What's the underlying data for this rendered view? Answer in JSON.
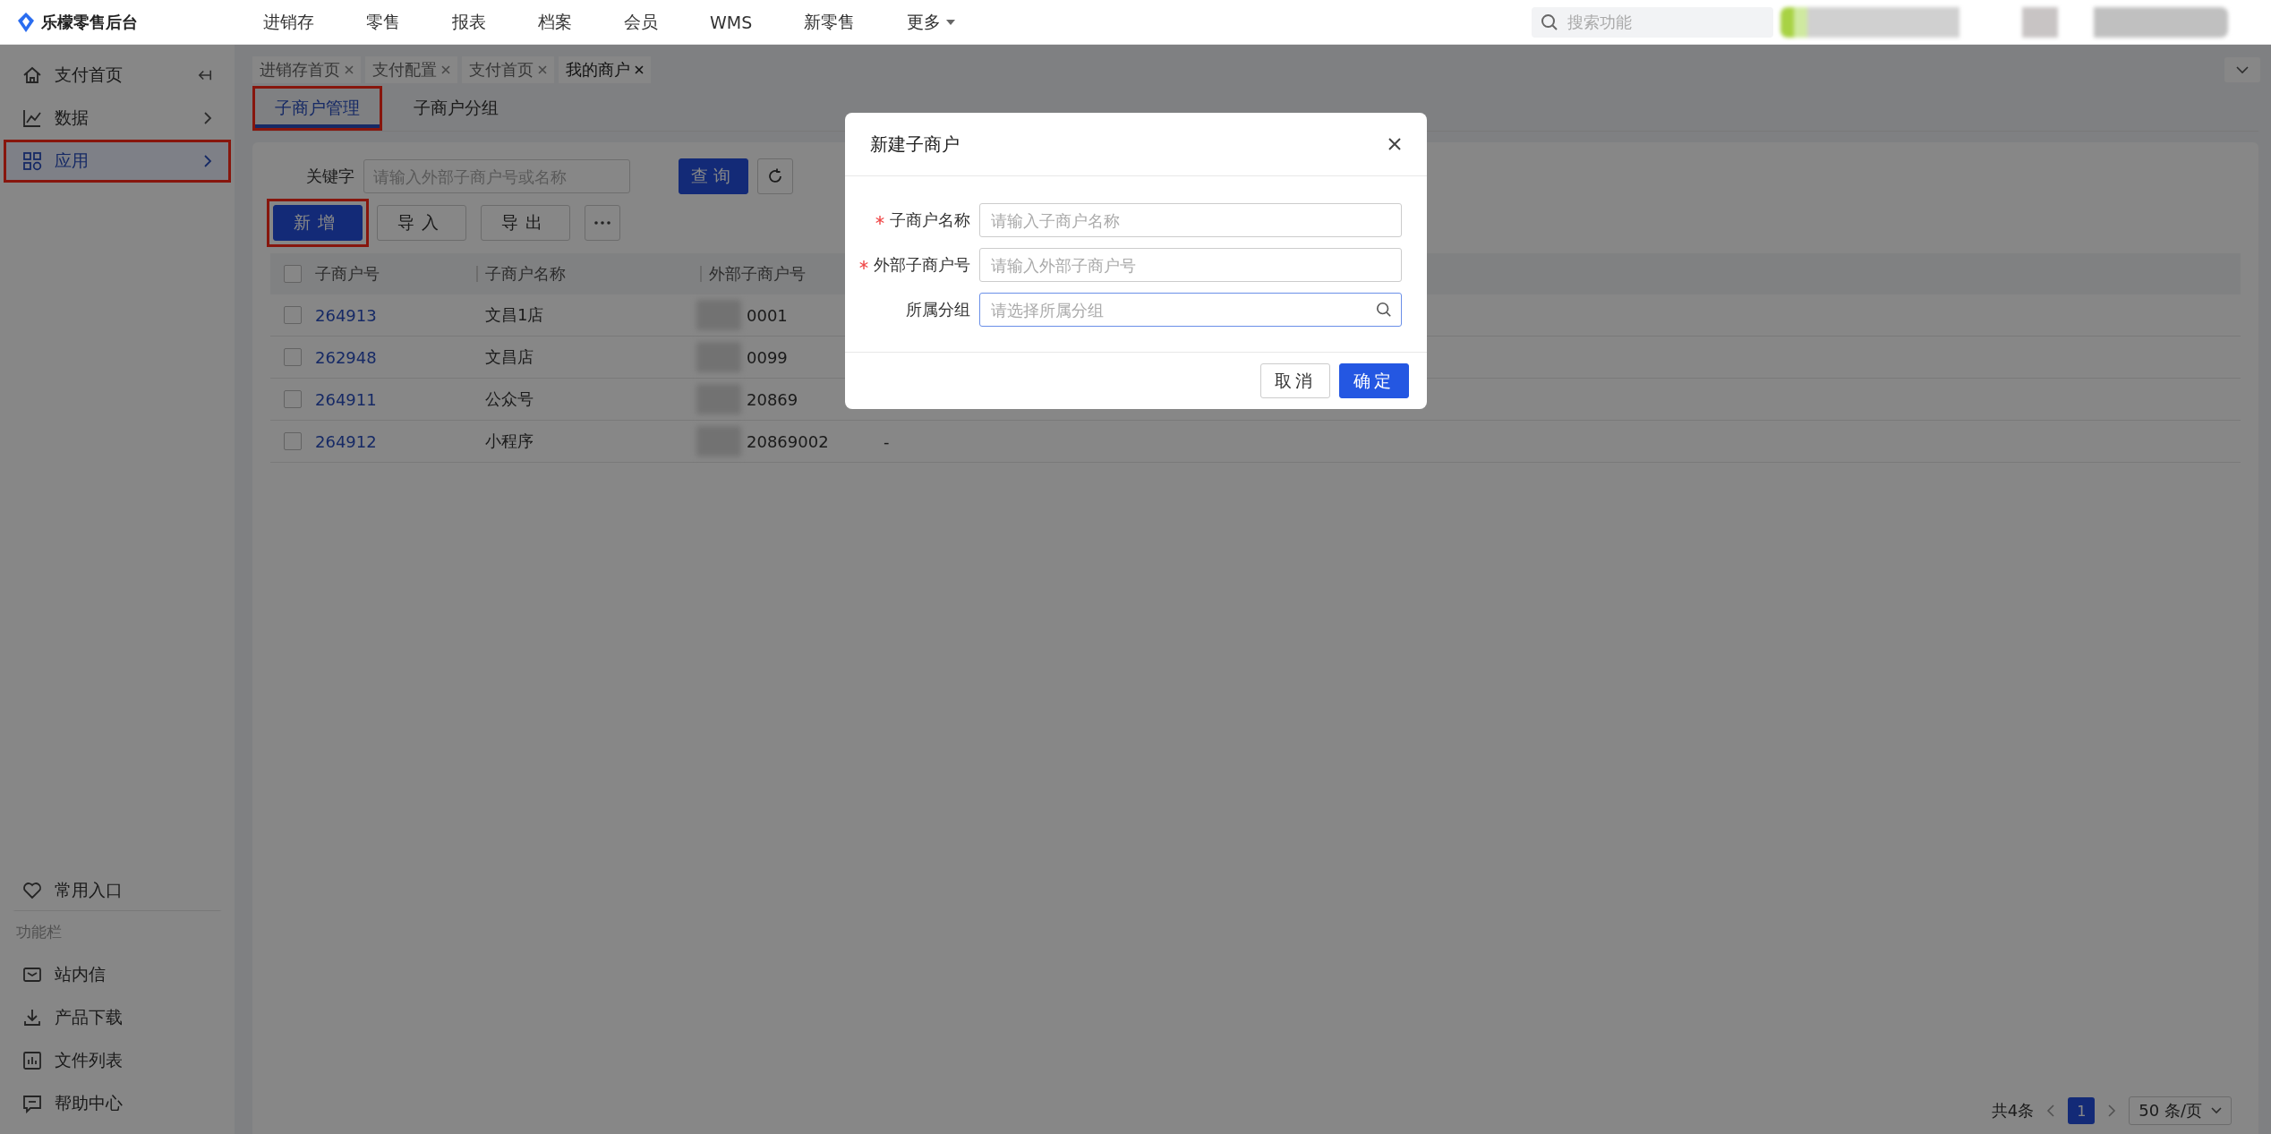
{
  "app": {
    "name": "乐檬零售后台"
  },
  "top_nav": [
    {
      "label": "进销存",
      "kind": "link"
    },
    {
      "label": "零售",
      "kind": "link"
    },
    {
      "label": "报表",
      "kind": "link"
    },
    {
      "label": "档案",
      "kind": "link"
    },
    {
      "label": "会员",
      "kind": "link"
    },
    {
      "label": "WMS",
      "kind": "link"
    },
    {
      "label": "新零售",
      "kind": "link"
    },
    {
      "label": "更多",
      "kind": "dropdown"
    }
  ],
  "search": {
    "placeholder": "搜索功能"
  },
  "page_tabs": [
    {
      "label": "进销存首页",
      "selected": false
    },
    {
      "label": "支付配置",
      "selected": false
    },
    {
      "label": "支付首页",
      "selected": false
    },
    {
      "label": "我的商户",
      "selected": true
    }
  ],
  "sidebar": {
    "items": [
      {
        "label": "支付首页",
        "selected": false,
        "highlighted": false
      },
      {
        "label": "数据",
        "selected": false,
        "highlighted": false
      },
      {
        "label": "应用",
        "selected": true,
        "highlighted": true
      }
    ],
    "favorites": "常用入口",
    "section_title": "功能栏",
    "tools": [
      {
        "label": "站内信"
      },
      {
        "label": "产品下载"
      },
      {
        "label": "文件列表"
      },
      {
        "label": "帮助中心"
      }
    ]
  },
  "subtabs": [
    {
      "label": "子商户管理",
      "selected": true,
      "highlighted": true
    },
    {
      "label": "子商户分组",
      "selected": false,
      "highlighted": false
    }
  ],
  "filter": {
    "label": "关键字",
    "placeholder": "请输入外部子商户号或名称",
    "query_button": "查询"
  },
  "actions": [
    {
      "label": "新增",
      "kind": "primary",
      "highlighted": true
    },
    {
      "label": "导入",
      "kind": "default",
      "highlighted": false
    },
    {
      "label": "导出",
      "kind": "default",
      "highlighted": false
    },
    {
      "kind": "more",
      "highlighted": false
    }
  ],
  "table": {
    "all_selected": false,
    "columns": [
      "子商户号",
      "子商户名称",
      "外部子商户号"
    ],
    "rows": [
      {
        "selected": false,
        "id": "264913",
        "name": "文昌1店",
        "external_id": "0001"
      },
      {
        "selected": false,
        "id": "262948",
        "name": "文昌店",
        "external_id": "0099"
      },
      {
        "selected": false,
        "id": "264911",
        "name": "公众号",
        "external_id": "20869"
      },
      {
        "selected": false,
        "id": "264912",
        "name": "小程序",
        "external_id": "20869002",
        "column_4": "-"
      }
    ]
  },
  "pagination": {
    "total": "共4条",
    "pages": [
      {
        "label": "1",
        "selected": true
      }
    ],
    "page_size": "50 条/页"
  },
  "dialog": {
    "title": "新建子商户",
    "fields": [
      {
        "label": "子商户名称",
        "required": true,
        "placeholder": "请输入子商户名称",
        "kind": "text",
        "focused": false
      },
      {
        "label": "外部子商户号",
        "required": true,
        "placeholder": "请输入外部子商户号",
        "kind": "text",
        "focused": false
      },
      {
        "label": "所属分组",
        "required": false,
        "placeholder": "请选择所属分组",
        "kind": "search",
        "focused": true
      }
    ],
    "buttons": [
      {
        "label": "取消",
        "kind": "default"
      },
      {
        "label": "确定",
        "kind": "primary"
      }
    ]
  }
}
